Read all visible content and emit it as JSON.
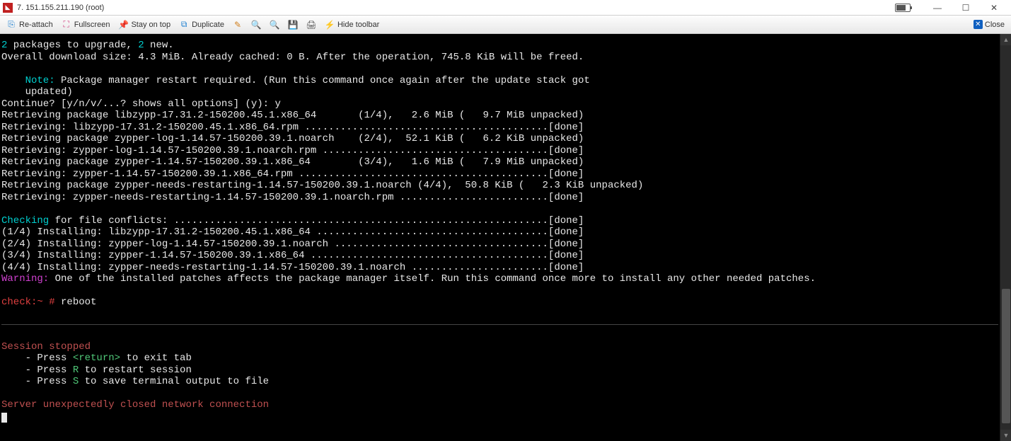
{
  "window": {
    "title": "7. 151.155.211.190 (root)"
  },
  "toolbar": {
    "reattach": "Re-attach",
    "fullscreen": "Fullscreen",
    "stayontop": "Stay on top",
    "duplicate": "Duplicate",
    "hidetoolbar": "Hide toolbar",
    "close": "Close"
  },
  "term": {
    "l1a": "2",
    "l1b": " packages to upgrade, ",
    "l1c": "2",
    "l1d": " new.",
    "l2": "Overall download size: 4.3 MiB. Already cached: 0 B. After the operation, 745.8 KiB will be freed.",
    "notelabel": "    Note:",
    "note1": " Package manager restart required. (Run this command once again after the update stack got",
    "note2": "    updated)",
    "cont": "Continue? [y/n/v/...? shows all options] (y): y",
    "p1_a": "Retrieving package libzypp-17.31.2-150200.45.1.x86_64",
    "p1_b": "(1/4),   2.6 MiB (   9.7 MiB unpacked)",
    "r1_a": "Retrieving: libzypp-17.31.2-150200.45.1.x86_64.rpm ",
    "done": "[done]",
    "p2_a": "Retrieving package zypper-log-1.14.57-150200.39.1.noarch",
    "p2_b": "(2/4),  52.1 KiB (   6.2 KiB unpacked)",
    "r2_a": "Retrieving: zypper-log-1.14.57-150200.39.1.noarch.rpm ",
    "p3_a": "Retrieving package zypper-1.14.57-150200.39.1.x86_64",
    "p3_b": "(3/4),   1.6 MiB (   7.9 MiB unpacked)",
    "r3_a": "Retrieving: zypper-1.14.57-150200.39.1.x86_64.rpm ",
    "p4_a": "Retrieving package zypper-needs-restarting-1.14.57-150200.39.1.noarch",
    "p4_b": "(4/4),  50.8 KiB (   2.3 KiB unpacked)",
    "r4_a": "Retrieving: zypper-needs-restarting-1.14.57-150200.39.1.noarch.rpm ",
    "chk_a": "Checking",
    "chk_b": " for file conflicts: ",
    "i1": "(1/4) Installing: libzypp-17.31.2-150200.45.1.x86_64 ",
    "i2": "(2/4) Installing: zypper-log-1.14.57-150200.39.1.noarch ",
    "i3": "(3/4) Installing: zypper-1.14.57-150200.39.1.x86_64 ",
    "i4": "(4/4) Installing: zypper-needs-restarting-1.14.57-150200.39.1.noarch ",
    "warnlabel": "Warning:",
    "warnmsg": " One of the installed patches affects the package manager itself. Run this command once more to install any other needed patches.",
    "prompt": "check:~ #",
    "cmd": " reboot",
    "sess": "Session stopped",
    "sess1a": "    - Press ",
    "sess1b": "<return>",
    "sess1c": " to exit tab",
    "sess2a": "    - Press ",
    "sess2b": "R",
    "sess2c": " to restart session",
    "sess3a": "    - Press ",
    "sess3b": "S",
    "sess3c": " to save terminal output to file",
    "err": "Server unexpectedly closed network connection"
  }
}
